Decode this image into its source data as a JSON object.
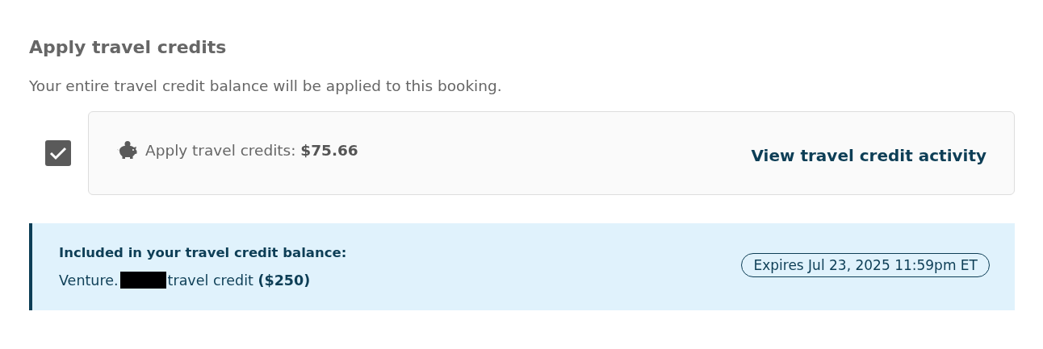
{
  "section": {
    "title": "Apply travel credits",
    "description": "Your entire travel credit balance will be applied to this booking."
  },
  "apply_option": {
    "checked": true,
    "label": "Apply travel credits: **$75.66**",
    "link": "View travel credit activity"
  },
  "balance_info": {
    "heading": "Included in your travel credit balance:",
    "credit_prefix": "Venture.",
    "redacted": true,
    "credit_suffix": "travel credit **($250)**",
    "expiry": "Expires Jul 23, 2025 11:59pm ET"
  }
}
